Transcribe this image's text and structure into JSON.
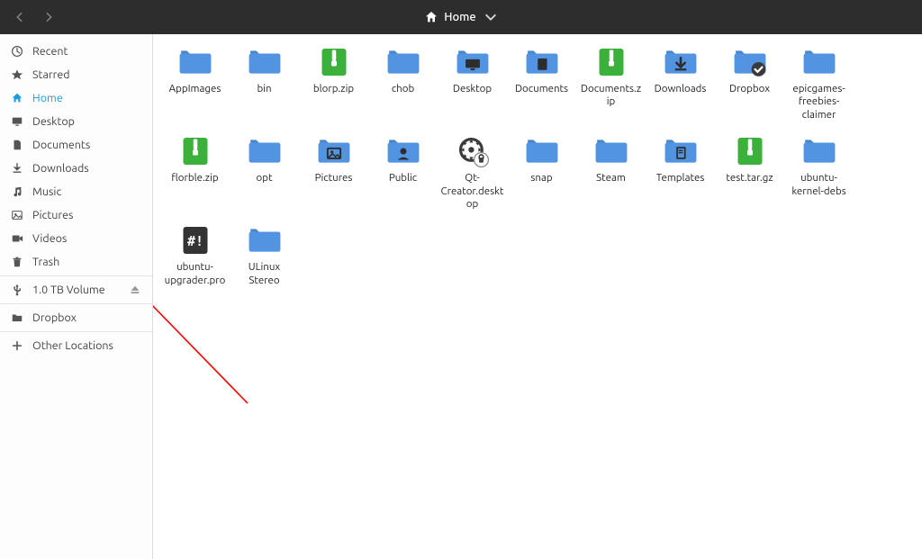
{
  "header": {
    "location_label": "Home"
  },
  "sidebar": {
    "places": [
      {
        "label": "Recent",
        "icon": "recent"
      },
      {
        "label": "Starred",
        "icon": "star"
      },
      {
        "label": "Home",
        "icon": "home",
        "active": true
      },
      {
        "label": "Desktop",
        "icon": "desktop"
      },
      {
        "label": "Documents",
        "icon": "document"
      },
      {
        "label": "Downloads",
        "icon": "download"
      },
      {
        "label": "Music",
        "icon": "music"
      },
      {
        "label": "Pictures",
        "icon": "picture"
      },
      {
        "label": "Videos",
        "icon": "video"
      },
      {
        "label": "Trash",
        "icon": "trash"
      }
    ],
    "devices": [
      {
        "label": "1.0 TB Volume",
        "icon": "usb",
        "eject": true
      }
    ],
    "bookmarks": [
      {
        "label": "Dropbox",
        "icon": "folder"
      }
    ],
    "other": [
      {
        "label": "Other Locations",
        "icon": "plus"
      }
    ]
  },
  "files": [
    {
      "name": "AppImages",
      "type": "folder"
    },
    {
      "name": "bin",
      "type": "folder"
    },
    {
      "name": "blorp.zip",
      "type": "zip"
    },
    {
      "name": "chob",
      "type": "folder"
    },
    {
      "name": "Desktop",
      "type": "folder-desktop"
    },
    {
      "name": "Documents",
      "type": "folder-documents"
    },
    {
      "name": "Documents.zip",
      "type": "zip"
    },
    {
      "name": "Downloads",
      "type": "folder-downloads"
    },
    {
      "name": "Dropbox",
      "type": "folder-synced"
    },
    {
      "name": "epicgames-freebies-claimer",
      "type": "folder"
    },
    {
      "name": "florble.zip",
      "type": "zip"
    },
    {
      "name": "opt",
      "type": "folder"
    },
    {
      "name": "Pictures",
      "type": "folder-pictures"
    },
    {
      "name": "Public",
      "type": "folder-public"
    },
    {
      "name": "Qt-Creator.desktop",
      "type": "desktop-entry"
    },
    {
      "name": "snap",
      "type": "folder"
    },
    {
      "name": "Steam",
      "type": "folder"
    },
    {
      "name": "Templates",
      "type": "folder-templates"
    },
    {
      "name": "test.tar.gz",
      "type": "zip"
    },
    {
      "name": "ubuntu-kernel-debs",
      "type": "folder"
    },
    {
      "name": "ubuntu-upgrader.pro",
      "type": "hashbang"
    },
    {
      "name": "ULinux Stereo",
      "type": "folder"
    }
  ],
  "annotation": {
    "arrow_points_to": "eject-icon-1tb-volume"
  }
}
